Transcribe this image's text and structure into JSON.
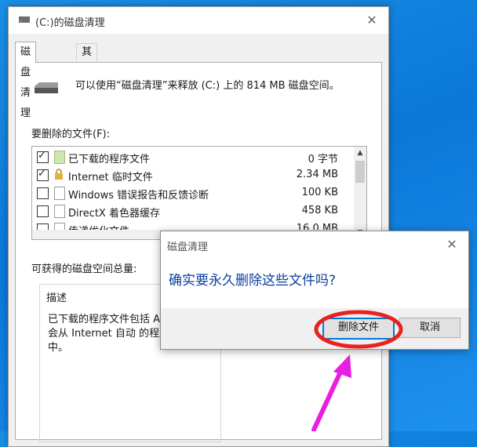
{
  "window": {
    "title": "(C:)的磁盘清理",
    "tabs": [
      {
        "label": "磁盘清理",
        "active": true
      },
      {
        "label": "其他选项",
        "active": false
      }
    ],
    "info_text": "可以使用“磁盘清理”来释放 (C:) 上的 814 MB 磁盘空间。",
    "files_label": "要删除的文件(F):",
    "files": [
      {
        "name": "已下载的程序文件",
        "size": "0 字节",
        "checked": true,
        "icon": "green-folder-icon"
      },
      {
        "name": "Internet 临时文件",
        "size": "2.34 MB",
        "checked": true,
        "icon": "lock-icon"
      },
      {
        "name": "Windows 错误报告和反馈诊断",
        "size": "100 KB",
        "checked": false,
        "icon": "file-icon"
      },
      {
        "name": "DirectX 着色器缓存",
        "size": "458 KB",
        "checked": false,
        "icon": "file-icon"
      },
      {
        "name": "传递优化文件",
        "size": "16.0 MB",
        "checked": false,
        "icon": "file-icon"
      }
    ],
    "available_label": "可获得的磁盘空间总量:",
    "description": {
      "title": "描述",
      "text": "已下载的程序文件包括 Ac 页时将会从 Internet 自动 的程序文件夹中。"
    }
  },
  "dialog": {
    "title": "磁盘清理",
    "message": "确实要永久删除这些文件吗?",
    "confirm_label": "删除文件",
    "cancel_label": "取消"
  },
  "colors": {
    "desktop": "#0b78d8",
    "annotation_red": "#e8231f",
    "annotation_arrow": "#e81ee0",
    "primary_border": "#0078d7"
  }
}
